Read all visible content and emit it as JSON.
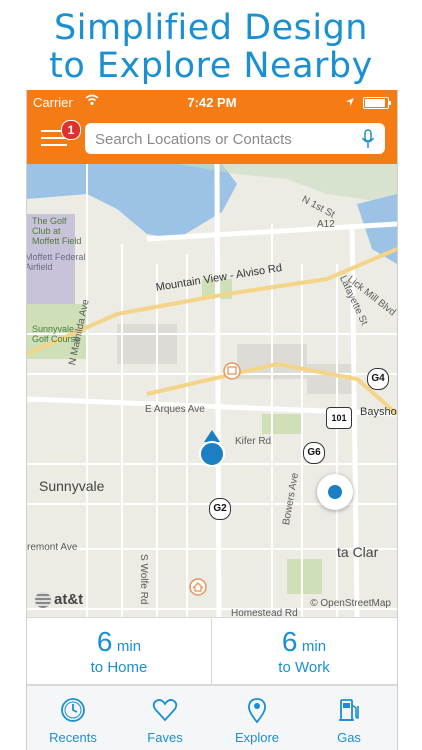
{
  "headline": {
    "line1": "Simplified Design",
    "line2": "to Explore Nearby"
  },
  "statusbar": {
    "carrier": "Carrier",
    "time": "7:42 PM"
  },
  "search": {
    "placeholder": "Search Locations or Contacts",
    "badge_count": "1"
  },
  "map": {
    "labels": {
      "golf_club": "The Golf\nClub at\nMoffett Field",
      "moffett_federal": "Moffett Federal\nAirfield",
      "sunnyvale_golf": "Sunnyvale\nGolf Course",
      "n_mathilda": "N Mathilda Ave",
      "mountain_view_alviso": "Mountain View - Alviso Rd",
      "lafayette": "Lafayette St",
      "lick_mill": "Lick Mill Blvd",
      "n_1st": "N 1st St",
      "e_arques": "E Arques Ave",
      "kifer": "Kifer Rd",
      "bayshore": "Baysho",
      "sunnyvale": "Sunnyvale",
      "bowers": "Bowers Ave",
      "fremont": "remont Ave",
      "s_wolfe": "S Wolfe Rd",
      "santa_clara": "ta Clar",
      "homestead": "Homestead Rd",
      "a12": "A12"
    },
    "route_badges": {
      "g4": "G4",
      "g6": "G6",
      "g2": "G2",
      "us101": "101"
    },
    "attribution": "© OpenStreetMap",
    "carrier_logo": "at&t"
  },
  "eta": [
    {
      "minutes": "6",
      "unit": "min",
      "destination": "to Home"
    },
    {
      "minutes": "6",
      "unit": "min",
      "destination": "to Work"
    }
  ],
  "tabs": [
    {
      "label": "Recents",
      "icon": "clock-icon"
    },
    {
      "label": "Faves",
      "icon": "heart-icon"
    },
    {
      "label": "Explore",
      "icon": "map-pin-icon"
    },
    {
      "label": "Gas",
      "icon": "gas-pump-icon"
    }
  ],
  "colors": {
    "accent": "#1a8fd1",
    "header": "#f57c14",
    "badge": "#e0312e",
    "map_bg": "#ecebe4",
    "water": "#9cc3e6"
  }
}
